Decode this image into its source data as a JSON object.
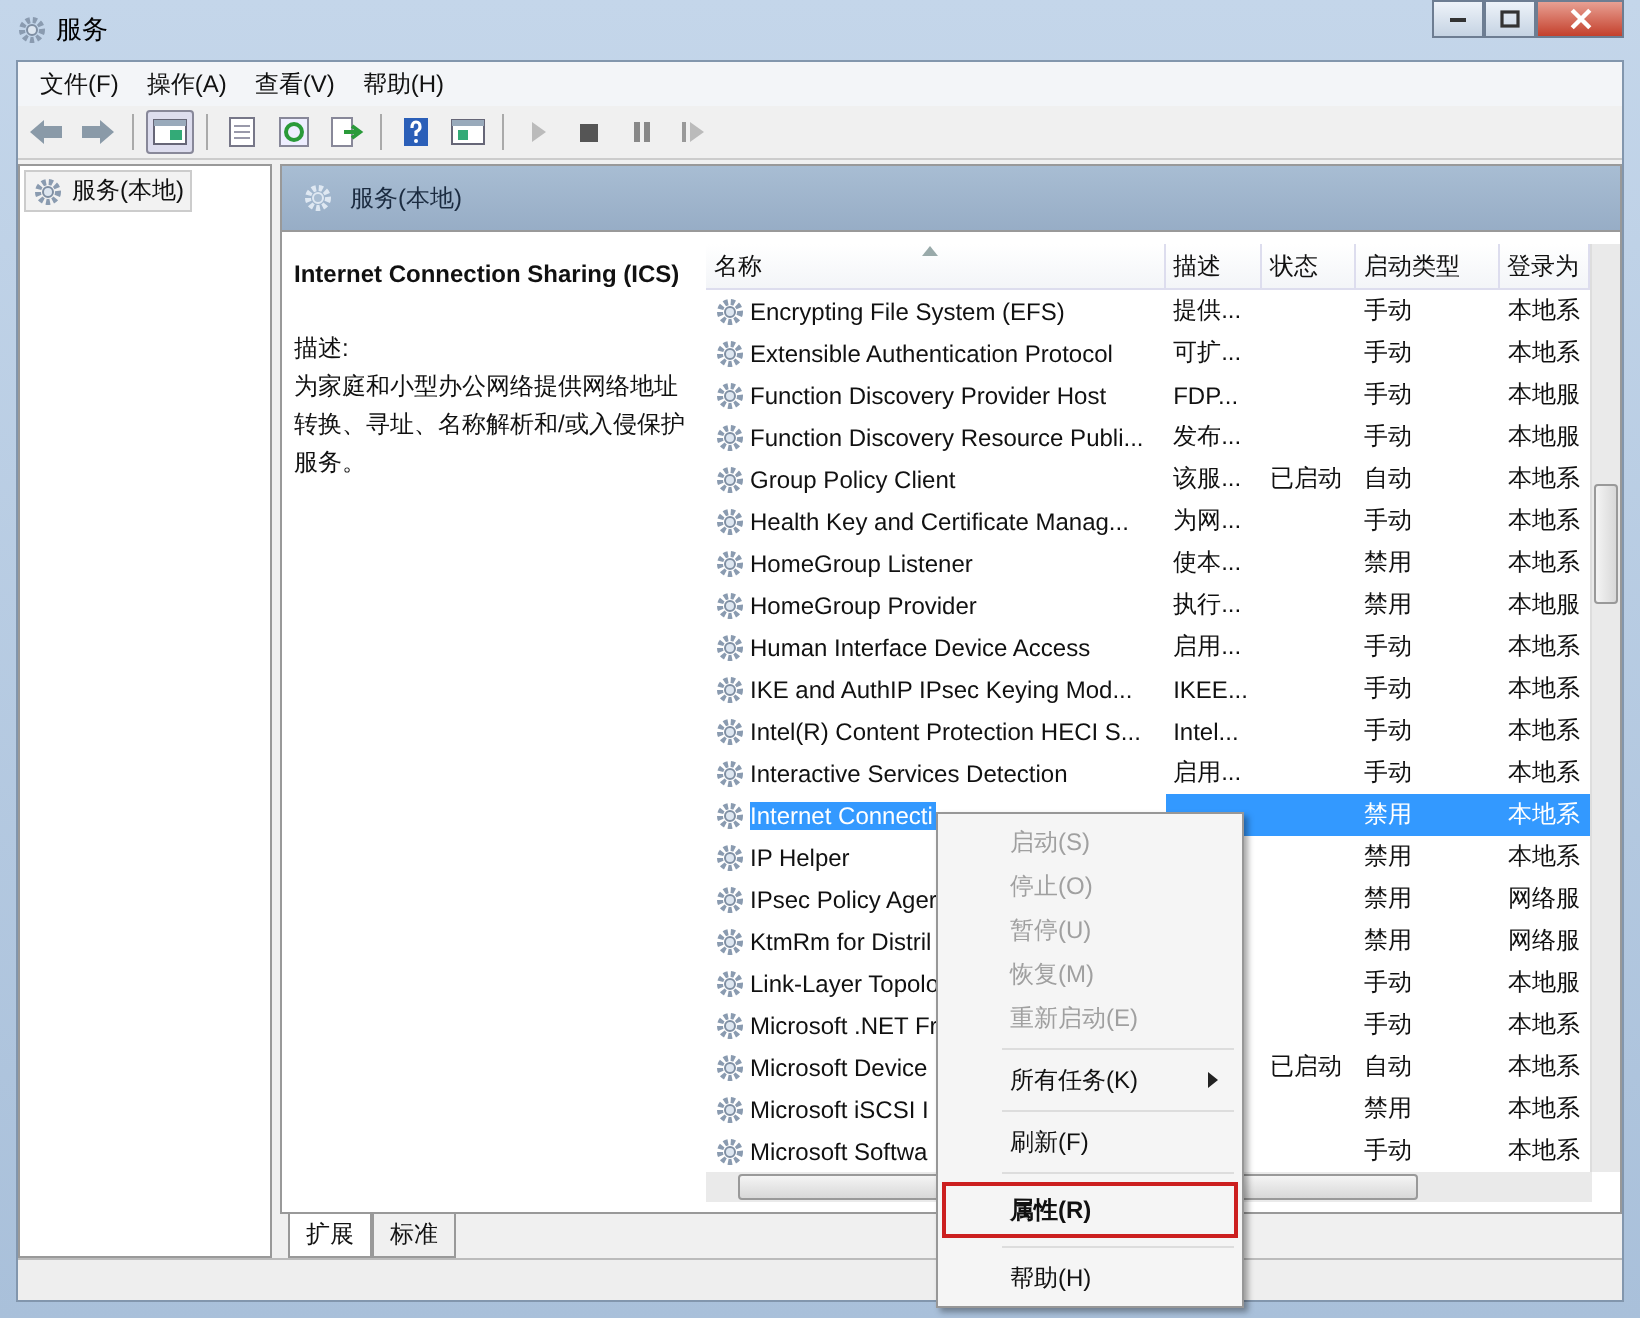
{
  "window": {
    "title": "服务"
  },
  "menu_bar": [
    "文件(F)",
    "操作(A)",
    "查看(V)",
    "帮助(H)"
  ],
  "tree": {
    "items": [
      {
        "label": "服务(本地)",
        "selected": true
      }
    ]
  },
  "pane_header": {
    "title": "服务(本地)"
  },
  "details": {
    "title": "Internet Connection Sharing (ICS)",
    "description_label": "描述:",
    "description": "为家庭和小型办公网络提供网络地址转换、寻址、名称解析和/或入侵保护服务。"
  },
  "table": {
    "columns": [
      "名称",
      "描述",
      "状态",
      "启动类型",
      "登录为"
    ],
    "rows": [
      {
        "name": "Encrypting File System (EFS)",
        "description": "提供...",
        "status": "",
        "startup": "手动",
        "logon": "本地系",
        "selected": false
      },
      {
        "name": "Extensible Authentication Protocol",
        "description": "可扩...",
        "status": "",
        "startup": "手动",
        "logon": "本地系",
        "selected": false
      },
      {
        "name": "Function Discovery Provider Host",
        "description": "FDP...",
        "status": "",
        "startup": "手动",
        "logon": "本地服",
        "selected": false
      },
      {
        "name": "Function Discovery Resource Publi...",
        "description": "发布...",
        "status": "",
        "startup": "手动",
        "logon": "本地服",
        "selected": false
      },
      {
        "name": "Group Policy Client",
        "description": "该服...",
        "status": "已启动",
        "startup": "自动",
        "logon": "本地系",
        "selected": false
      },
      {
        "name": "Health Key and Certificate Manag...",
        "description": "为网...",
        "status": "",
        "startup": "手动",
        "logon": "本地系",
        "selected": false
      },
      {
        "name": "HomeGroup Listener",
        "description": "使本...",
        "status": "",
        "startup": "禁用",
        "logon": "本地系",
        "selected": false
      },
      {
        "name": "HomeGroup Provider",
        "description": "执行...",
        "status": "",
        "startup": "禁用",
        "logon": "本地服",
        "selected": false
      },
      {
        "name": "Human Interface Device Access",
        "description": "启用...",
        "status": "",
        "startup": "手动",
        "logon": "本地系",
        "selected": false
      },
      {
        "name": "IKE and AuthIP IPsec Keying Mod...",
        "description": "IKEE...",
        "status": "",
        "startup": "手动",
        "logon": "本地系",
        "selected": false
      },
      {
        "name": "Intel(R) Content Protection HECI S...",
        "description": "Intel...",
        "status": "",
        "startup": "手动",
        "logon": "本地系",
        "selected": false
      },
      {
        "name": "Interactive Services Detection",
        "description": "启用...",
        "status": "",
        "startup": "手动",
        "logon": "本地系",
        "selected": false
      },
      {
        "name": "Internet Connecti",
        "description": "",
        "status": "",
        "startup": "禁用",
        "logon": "本地系",
        "selected": true
      },
      {
        "name": "IP Helper",
        "description": "",
        "status": "",
        "startup": "禁用",
        "logon": "本地系",
        "selected": false
      },
      {
        "name": "IPsec Policy Ager",
        "description": "",
        "status": "",
        "startup": "禁用",
        "logon": "网络服",
        "selected": false
      },
      {
        "name": "KtmRm for Distril",
        "description": "",
        "status": "",
        "startup": "禁用",
        "logon": "网络服",
        "selected": false
      },
      {
        "name": "Link-Layer Topolo",
        "description": "",
        "status": "",
        "startup": "手动",
        "logon": "本地服",
        "selected": false
      },
      {
        "name": "Microsoft .NET Fr",
        "description": "",
        "status": "",
        "startup": "手动",
        "logon": "本地系",
        "selected": false
      },
      {
        "name": "Microsoft Device",
        "description": "",
        "status": "已启动",
        "startup": "自动",
        "logon": "本地系",
        "selected": false
      },
      {
        "name": "Microsoft iSCSI I",
        "description": "",
        "status": "",
        "startup": "禁用",
        "logon": "本地系",
        "selected": false
      },
      {
        "name": "Microsoft Softwa",
        "description": "",
        "status": "",
        "startup": "手动",
        "logon": "本地系",
        "selected": false
      }
    ]
  },
  "view_tabs": [
    {
      "label": "扩展",
      "selected": true
    },
    {
      "label": "标准",
      "selected": false
    }
  ],
  "context_menu": [
    {
      "kind": "item",
      "label": "启动(S)",
      "disabled": true,
      "submenu": false,
      "highlighted": false,
      "bold": false
    },
    {
      "kind": "item",
      "label": "停止(O)",
      "disabled": true,
      "submenu": false,
      "highlighted": false,
      "bold": false
    },
    {
      "kind": "item",
      "label": "暂停(U)",
      "disabled": true,
      "submenu": false,
      "highlighted": false,
      "bold": false
    },
    {
      "kind": "item",
      "label": "恢复(M)",
      "disabled": true,
      "submenu": false,
      "highlighted": false,
      "bold": false
    },
    {
      "kind": "item",
      "label": "重新启动(E)",
      "disabled": true,
      "submenu": false,
      "highlighted": false,
      "bold": false
    },
    {
      "kind": "separator"
    },
    {
      "kind": "item",
      "label": "所有任务(K)",
      "disabled": false,
      "submenu": true,
      "highlighted": false,
      "bold": false
    },
    {
      "kind": "separator"
    },
    {
      "kind": "item",
      "label": "刷新(F)",
      "disabled": false,
      "submenu": false,
      "highlighted": false,
      "bold": false
    },
    {
      "kind": "separator"
    },
    {
      "kind": "item",
      "label": "属性(R)",
      "disabled": false,
      "submenu": false,
      "highlighted": true,
      "bold": true
    },
    {
      "kind": "separator"
    },
    {
      "kind": "item",
      "label": "帮助(H)",
      "disabled": false,
      "submenu": false,
      "highlighted": false,
      "bold": false
    }
  ]
}
